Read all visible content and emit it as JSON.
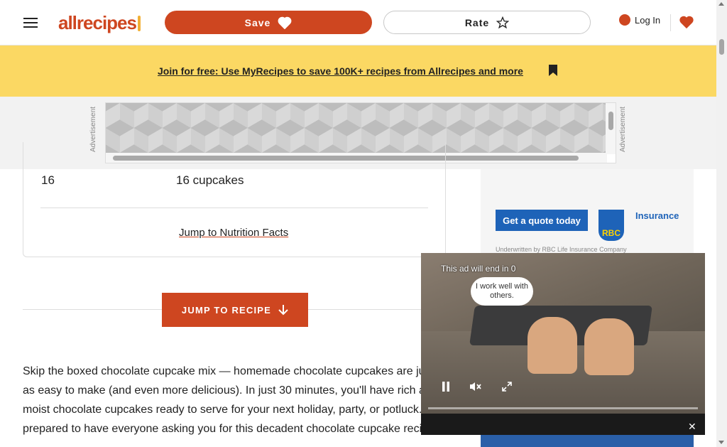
{
  "header": {
    "logo_text": "allrecipes",
    "save_label": "Save",
    "rate_label": "Rate",
    "login_label": "Log In"
  },
  "banner": {
    "text": "Join for free: Use MyRecipes to save 100K+ recipes from Allrecipes and more"
  },
  "ad_strip": {
    "label_left": "Advertisement",
    "label_right": "Advertisement"
  },
  "recipe": {
    "servings_value": "16",
    "yield_value": "16 cupcakes",
    "nutrition_link": "Jump to Nutrition Facts",
    "jump_button": "JUMP TO RECIPE",
    "intro_text": "Skip the boxed chocolate cupcake mix — homemade chocolate cupcakes are just as easy to make (and even more delicious). In just 30 minutes, you'll have rich and moist chocolate cupcakes ready to serve for your next holiday, party, or potluck. Be prepared to have everyone asking you for this decadent chocolate cupcake recipe!"
  },
  "side_ad": {
    "button_text": "Get a quote today",
    "brand": "RBC",
    "product": "Insurance",
    "fine_print": "Underwritten by RBC Life Insurance Company"
  },
  "video_ad": {
    "timer_text": "This ad will end in 0",
    "bubble_text": "I work well with others."
  },
  "colors": {
    "brand": "#ce4620",
    "banner": "#fbd863",
    "rbc_blue": "#1e63b8"
  },
  "icons": [
    "menu-icon",
    "heart-icon",
    "star-icon",
    "user-icon",
    "bookmark-icon",
    "arrow-down-icon",
    "pause-icon",
    "mute-icon",
    "fullscreen-icon",
    "close-icon"
  ]
}
